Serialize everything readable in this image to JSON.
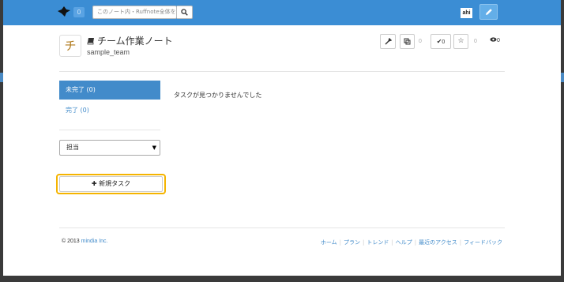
{
  "navbar": {
    "notification_count": "0",
    "search_placeholder": "このノート内・Ruffnote全体を検",
    "avatar_text": "ahi"
  },
  "note": {
    "icon_char": "チ",
    "title": "チーム作業ノート",
    "team": "sample_team",
    "fork_count": "0",
    "check_count": "0",
    "star_count": "0",
    "view_count": "0"
  },
  "sidebar": {
    "tab_incomplete": "未完了 (0)",
    "tab_complete": "完了 (0)",
    "assignee_select": "担当",
    "new_task_button": "新規タスク"
  },
  "main": {
    "empty_message": "タスクが見つかりませんでした"
  },
  "footer": {
    "copyright_prefix": "© 2013",
    "company": "mindia Inc.",
    "links": [
      "ホーム",
      "プラン",
      "トレンド",
      "ヘルプ",
      "最近のアクセス",
      "フィードバック"
    ]
  },
  "colors": {
    "navbar": "#3b8dd4",
    "accent": "#428bca",
    "highlight": "#f5b400"
  }
}
